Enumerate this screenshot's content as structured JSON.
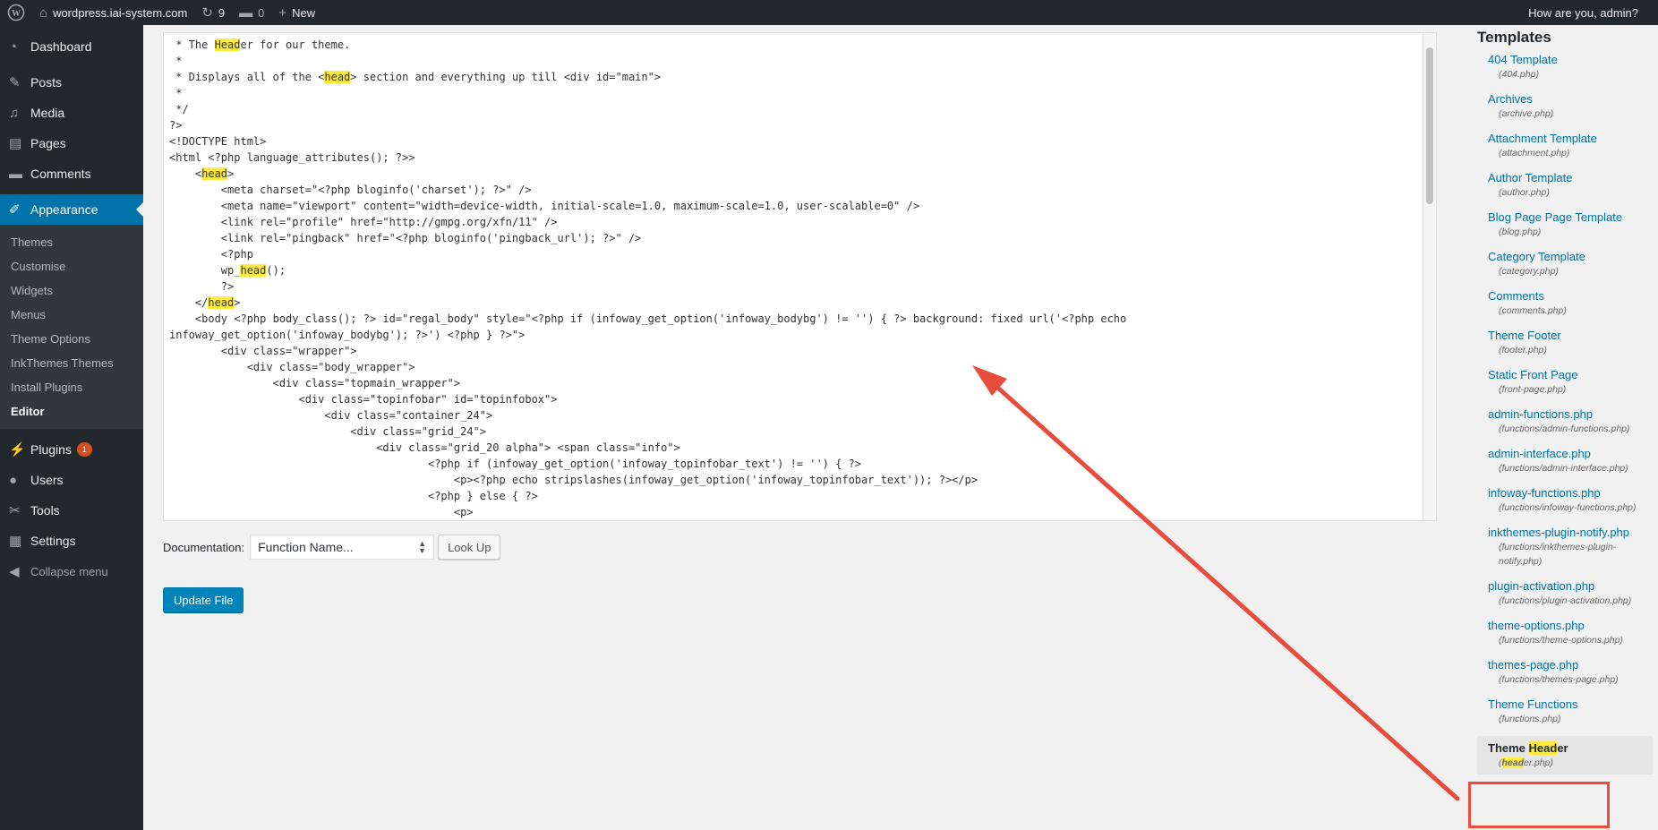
{
  "adminbar": {
    "site_name": "wordpress.iai-system.com",
    "updates_count": "9",
    "comments_count": "0",
    "new_label": "New",
    "greeting": "How are you, admin?"
  },
  "menu": {
    "dashboard": "Dashboard",
    "posts": "Posts",
    "media": "Media",
    "pages": "Pages",
    "comments": "Comments",
    "appearance": "Appearance",
    "submenu": [
      "Themes",
      "Customise",
      "Widgets",
      "Menus",
      "Theme Options",
      "InkThemes Themes",
      "Install Plugins",
      "Editor"
    ],
    "plugins": "Plugins",
    "plugins_badge": "1",
    "users": "Users",
    "tools": "Tools",
    "settings": "Settings",
    "collapse": "Collapse menu"
  },
  "editor": {
    "lines": [
      " * The Header for our theme.",
      " *",
      " * Displays all of the <head> section and everything up till <div id=\"main\">",
      " *",
      " */",
      "?>",
      "<!DOCTYPE html>",
      "<html <?php language_attributes(); ?>>",
      "    <head>",
      "        <meta charset=\"<?php bloginfo('charset'); ?>\" />",
      "        <meta name=\"viewport\" content=\"width=device-width, initial-scale=1.0, maximum-scale=1.0, user-scalable=0\" />",
      "        <link rel=\"profile\" href=\"http://gmpg.org/xfn/11\" />",
      "        <link rel=\"pingback\" href=\"<?php bloginfo('pingback_url'); ?>\" />",
      "        <?php",
      "        wp_head();",
      "        ?>",
      "    </head>",
      "    <body <?php body_class(); ?> id=\"regal_body\" style=\"<?php if (infoway_get_option('infoway_bodybg') != '') { ?> background: fixed url('<?php echo",
      "infoway_get_option('infoway_bodybg'); ?>') <?php } ?>\">",
      "        <div class=\"wrapper\">",
      "            <div class=\"body_wrapper\">",
      "                <div class=\"topmain_wrapper\">",
      "                    <div class=\"topinfobar\" id=\"topinfobox\">",
      "                        <div class=\"container_24\">",
      "                            <div class=\"grid_24\">",
      "                                <div class=\"grid_20 alpha\"> <span class=\"info\">",
      "                                        <?php if (infoway_get_option('infoway_topinfobar_text') != '') { ?>",
      "                                            <p><?php echo stripslashes(infoway_get_option('infoway_topinfobar_text')); ?></p>",
      "                                        <?php } else { ?>",
      "                                            <p>"
    ]
  },
  "documentation": {
    "label": "Documentation:",
    "selected": "Function Name...",
    "lookup": "Look Up"
  },
  "update_button": "Update File",
  "templates": {
    "title": "Templates",
    "items": [
      {
        "name": "404 Template",
        "file": "(404.php)"
      },
      {
        "name": "Archives",
        "file": "(archive.php)"
      },
      {
        "name": "Attachment Template",
        "file": "(attachment.php)"
      },
      {
        "name": "Author Template",
        "file": "(author.php)"
      },
      {
        "name": "Blog Page Page Template",
        "file": "(blog.php)"
      },
      {
        "name": "Category Template",
        "file": "(category.php)"
      },
      {
        "name": "Comments",
        "file": "(comments.php)"
      },
      {
        "name": "Theme Footer",
        "file": "(footer.php)"
      },
      {
        "name": "Static Front Page",
        "file": "(front-page.php)"
      },
      {
        "name": "admin-functions.php",
        "file": "(functions/admin-functions.php)"
      },
      {
        "name": "admin-interface.php",
        "file": "(functions/admin-interface.php)"
      },
      {
        "name": "infoway-functions.php",
        "file": "(functions/infoway-functions.php)"
      },
      {
        "name": "inkthemes-plugin-notify.php",
        "file": "(functions/inkthemes-plugin-notify.php)"
      },
      {
        "name": "plugin-activation.php",
        "file": "(functions/plugin-activation.php)"
      },
      {
        "name": "theme-options.php",
        "file": "(functions/theme-options.php)"
      },
      {
        "name": "themes-page.php",
        "file": "(functions/themes-page.php)"
      },
      {
        "name": "Theme Functions",
        "file": "(functions.php)"
      }
    ],
    "current": {
      "name_pre": "Theme ",
      "name_hl": "Head",
      "name_post": "er",
      "file_pre": "(",
      "file_hl": "head",
      "file_post": "er.php)"
    }
  },
  "colors": {
    "accent": "#0073aa",
    "annotation": "#e74c3c",
    "highlight": "#ffeb3b"
  }
}
